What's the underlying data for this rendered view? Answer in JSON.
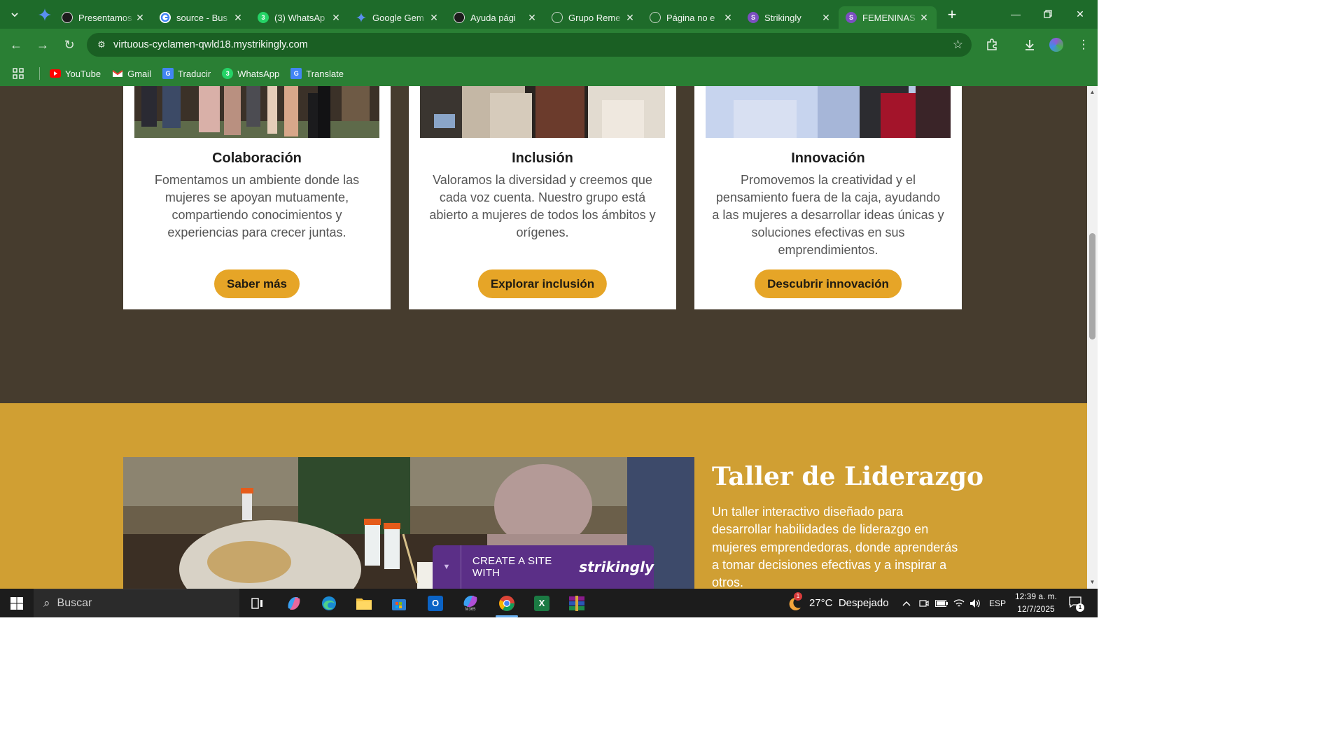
{
  "browser": {
    "tabs": [
      {
        "title": "Presentamos",
        "favicon": "openai-icon",
        "color": "#1c1c1c"
      },
      {
        "title": "source - Bus",
        "favicon": "google-icon",
        "color": "#ffffff"
      },
      {
        "title": "(3) WhatsAp",
        "favicon": "whatsapp-icon",
        "color": "#25d366"
      },
      {
        "title": "Google Gem",
        "favicon": "gemini-icon",
        "color": "#4b7be5"
      },
      {
        "title": "Ayuda pági",
        "favicon": "openai-icon",
        "color": "#1c1c1c"
      },
      {
        "title": "Grupo Reme",
        "favicon": "globe-icon",
        "color": "#c9d6c9"
      },
      {
        "title": "Página no e",
        "favicon": "globe-icon",
        "color": "#c9d6c9"
      },
      {
        "title": "Strikingly",
        "favicon": "strikingly-icon",
        "color": "#7b4fc0"
      },
      {
        "title": "FEMENINAS",
        "favicon": "strikingly-icon",
        "color": "#7b4fc0",
        "active": true
      }
    ],
    "whatsapp_badge": "3",
    "strikingly_badge": "S",
    "url": "virtuous-cyclamen-qwld18.mystrikingly.com",
    "bookmarks": [
      {
        "label": "YouTube",
        "icon": "youtube-icon",
        "color": "#ff0000"
      },
      {
        "label": "Gmail",
        "icon": "gmail-icon",
        "color": "#ea4335"
      },
      {
        "label": "Traducir",
        "icon": "translate-icon",
        "color": "#4285f4"
      },
      {
        "label": "WhatsApp",
        "icon": "whatsapp-icon",
        "color": "#25d366"
      },
      {
        "label": "Translate",
        "icon": "translate-icon",
        "color": "#4285f4"
      }
    ],
    "chrome_color": "#2a7f34"
  },
  "page": {
    "cards": [
      {
        "title": "Colaboración",
        "body": "Fomentamos un ambiente donde las mujeres se apoyan mutuamente, compartiendo conocimientos y experiencias para crecer juntas.",
        "button": "Saber más"
      },
      {
        "title": "Inclusión",
        "body": "Valoramos la diversidad y creemos que cada voz cuenta. Nuestro grupo está abierto a mujeres de todos los ámbitos y orígenes.",
        "button": "Explorar inclusión"
      },
      {
        "title": "Innovación",
        "body": "Promovemos la creatividad y el pensamiento fuera de la caja, ayudando a las mujeres a desarrollar ideas únicas y soluciones efectivas en sus emprendimientos.",
        "button": "Descubrir innovación"
      }
    ],
    "taller": {
      "title": "Taller de Liderazgo",
      "body": "Un taller interactivo diseñado para desarrollar habilidades de liderazgo en mujeres emprendedoras, donde aprenderás a tomar decisiones efectivas y a inspirar a otros."
    },
    "strikingly_banner": {
      "text": "CREATE A SITE WITH",
      "brand": "strikingly"
    },
    "colors": {
      "dark_bg": "#463c2e",
      "gold_bg": "#d09f33",
      "button": "#e6a527",
      "banner": "#5b2f87"
    }
  },
  "taskbar": {
    "search_placeholder": "Buscar",
    "weather_badge": "1",
    "weather": "27°C  Despejado",
    "language": "ESP",
    "time": "12:39 a. m.",
    "date": "12/7/2025",
    "notification_count": "1",
    "outlook_letter": "O",
    "excel_letter": "X",
    "m365_label": "M365"
  }
}
